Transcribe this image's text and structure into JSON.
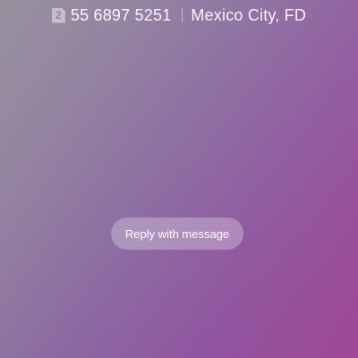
{
  "caller": {
    "sim_slot": "2",
    "phone_number": "55 6897 5251",
    "location": "Mexico City, FD"
  },
  "actions": {
    "reply_with_message_label": "Reply with message"
  }
}
